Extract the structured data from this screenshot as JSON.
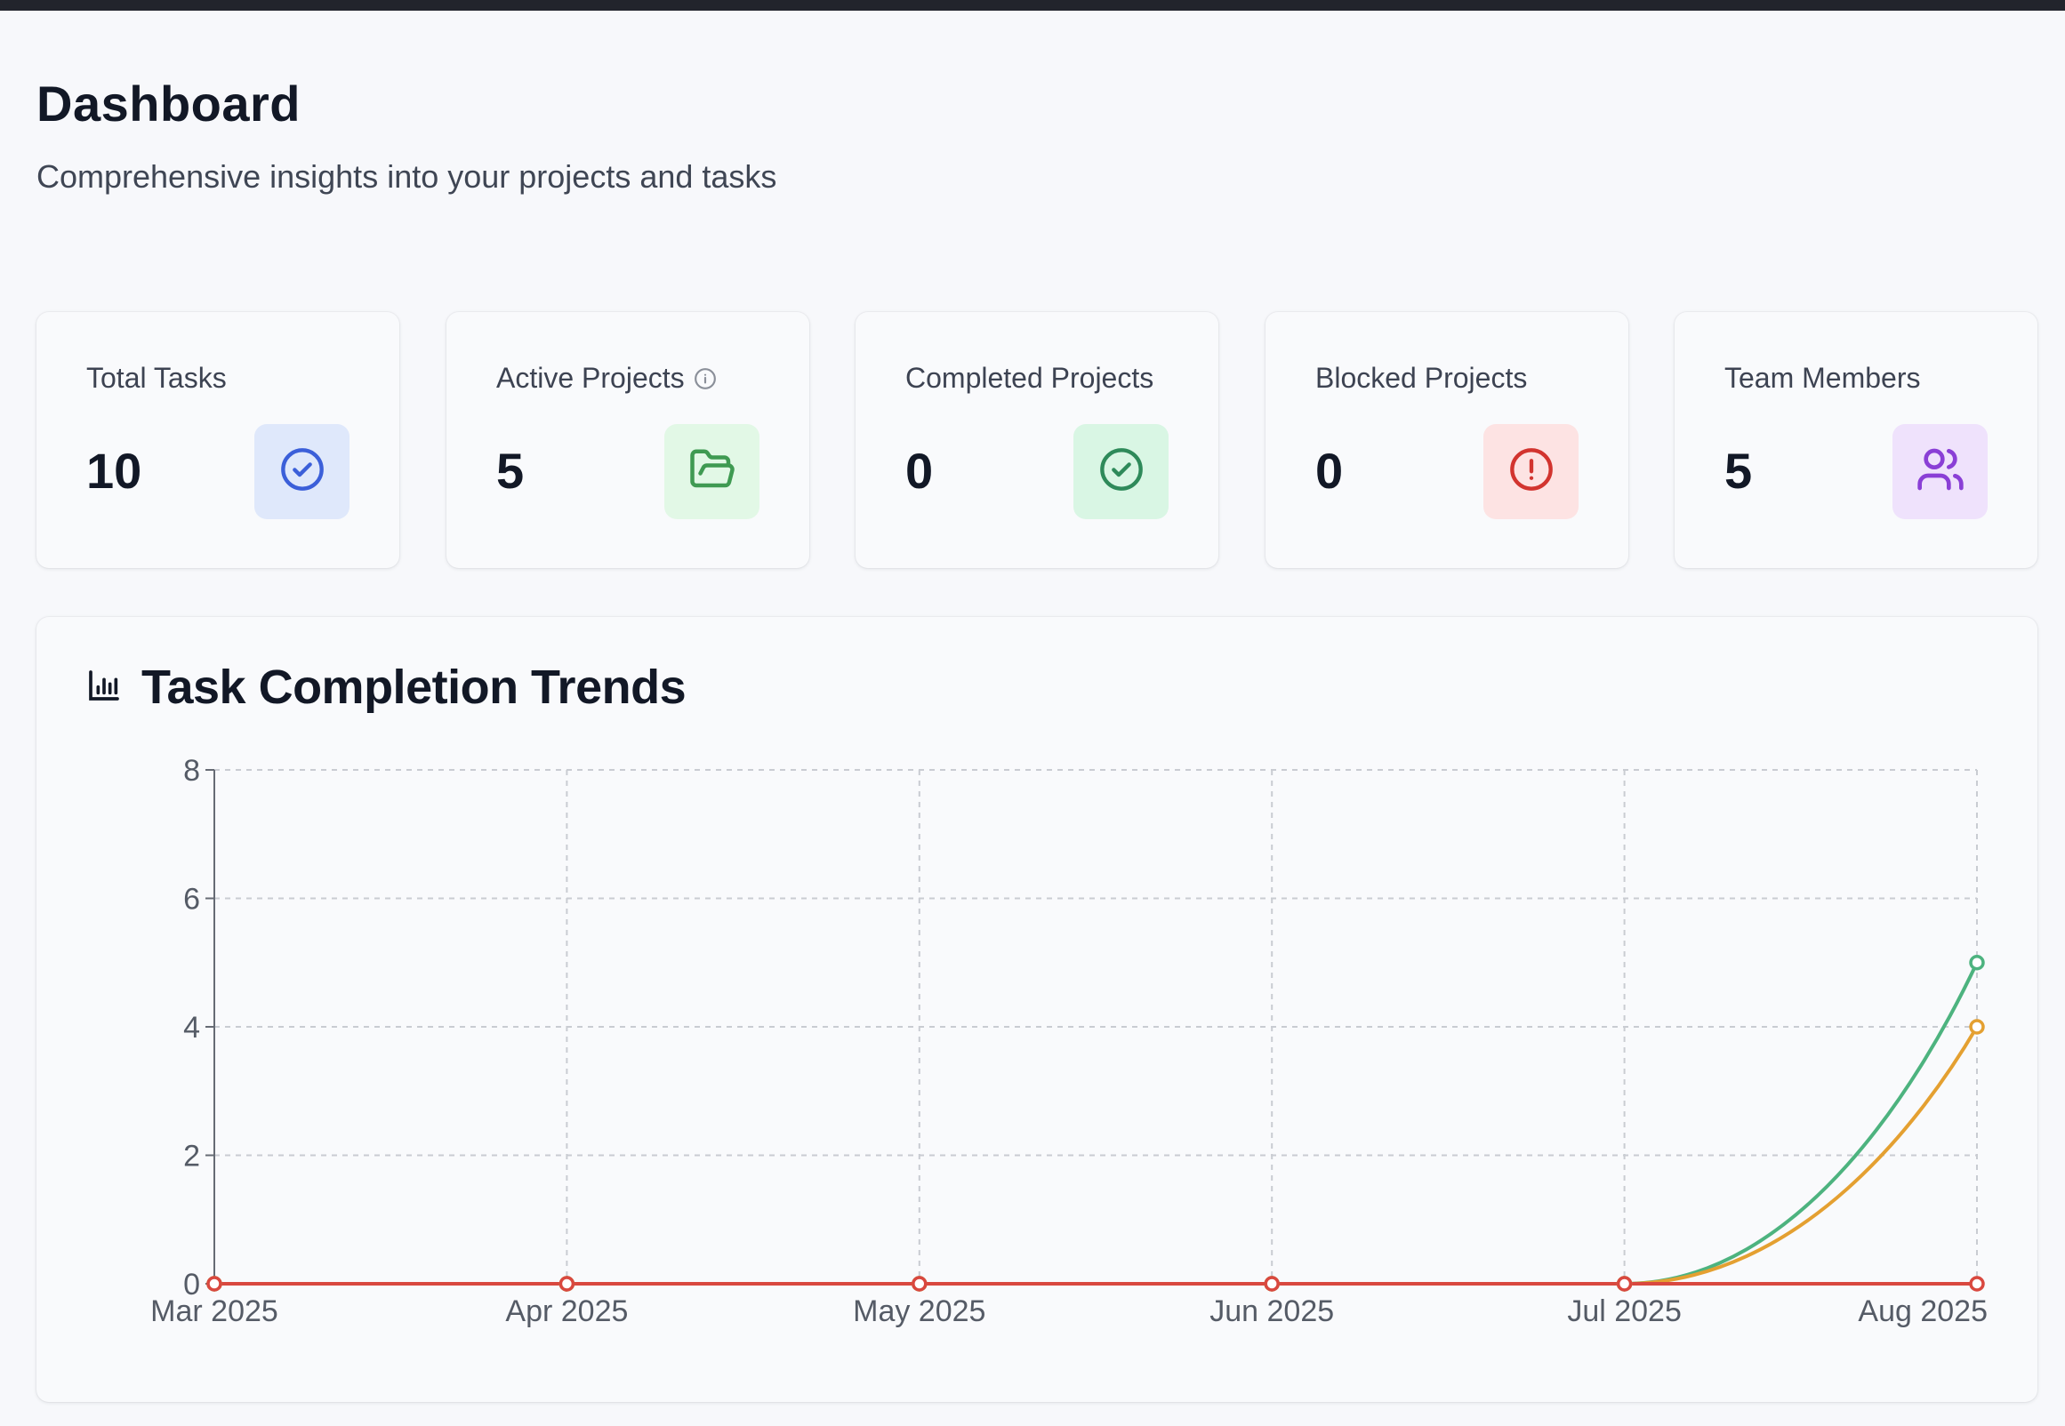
{
  "header": {
    "title": "Dashboard",
    "subtitle": "Comprehensive insights into your projects and tasks"
  },
  "stats": [
    {
      "label": "Total Tasks",
      "value": "10",
      "icon": "check-circle-icon",
      "icon_color": "#3b5fd9",
      "icon_bg": "#dfe8fb"
    },
    {
      "label": "Active Projects",
      "value": "5",
      "icon": "folder-open-icon",
      "icon_color": "#3f9a52",
      "icon_bg": "#e2f8e6",
      "has_info": true
    },
    {
      "label": "Completed Projects",
      "value": "0",
      "icon": "check-circle-icon",
      "icon_color": "#2e8a5a",
      "icon_bg": "#d9f6e4"
    },
    {
      "label": "Blocked Projects",
      "value": "0",
      "icon": "alert-circle-icon",
      "icon_color": "#d2342f",
      "icon_bg": "#fde3e3"
    },
    {
      "label": "Team Members",
      "value": "5",
      "icon": "users-icon",
      "icon_color": "#8a3fd6",
      "icon_bg": "#efe2fc"
    }
  ],
  "chart": {
    "title": "Task Completion Trends",
    "icon": "bar-chart-icon"
  },
  "chart_data": {
    "type": "line",
    "x": [
      "Mar 2025",
      "Apr 2025",
      "May 2025",
      "Jun 2025",
      "Jul 2025",
      "Aug 2025"
    ],
    "ylim": [
      0,
      8
    ],
    "yticks": [
      0,
      2,
      4,
      6,
      8
    ],
    "grid": true,
    "series": [
      {
        "color": "#4db37f",
        "values": [
          0,
          0,
          0,
          0,
          0,
          5
        ]
      },
      {
        "color": "#e4a031",
        "values": [
          0,
          0,
          0,
          0,
          0,
          4
        ]
      },
      {
        "color": "#d9483f",
        "values": [
          0,
          0,
          0,
          0,
          0,
          0
        ]
      }
    ]
  }
}
